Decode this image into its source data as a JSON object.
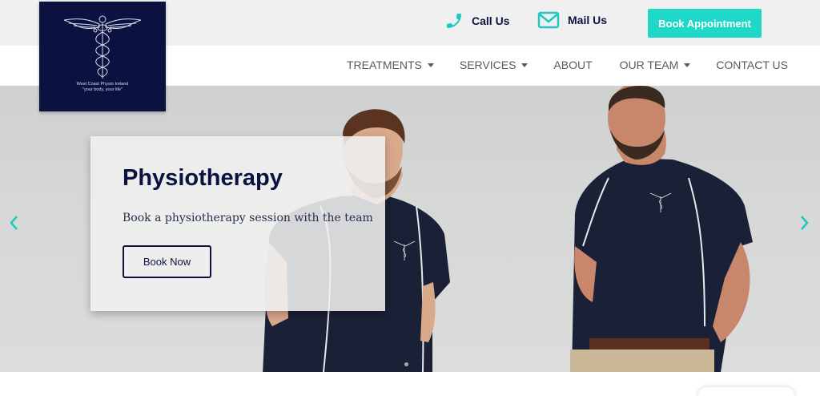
{
  "topbar": {
    "call_label": "Call Us",
    "mail_label": "Mail Us",
    "book_label": "Book Appointment"
  },
  "logo": {
    "line1": "West Coast Physio Ireland",
    "line2": "\"your body, your life\""
  },
  "nav": {
    "items": [
      {
        "label": "TREATMENTS",
        "has_dropdown": true
      },
      {
        "label": "SERVICES",
        "has_dropdown": true
      },
      {
        "label": "ABOUT",
        "has_dropdown": false
      },
      {
        "label": "OUR TEAM",
        "has_dropdown": true
      },
      {
        "label": "CONTACT US",
        "has_dropdown": false
      }
    ]
  },
  "hero": {
    "title": "Physiotherapy",
    "subtitle": "Book a physiotherapy session with the team",
    "button_label": "Book Now",
    "slide_index": 1,
    "slide_count": 2
  },
  "colors": {
    "accent": "#1fd8c8",
    "navy": "#0b1240",
    "nav_text": "#555a64"
  },
  "icons": {
    "call": "phone-icon",
    "mail": "mail-icon",
    "prev": "chevron-left-icon",
    "next": "chevron-right-icon"
  }
}
